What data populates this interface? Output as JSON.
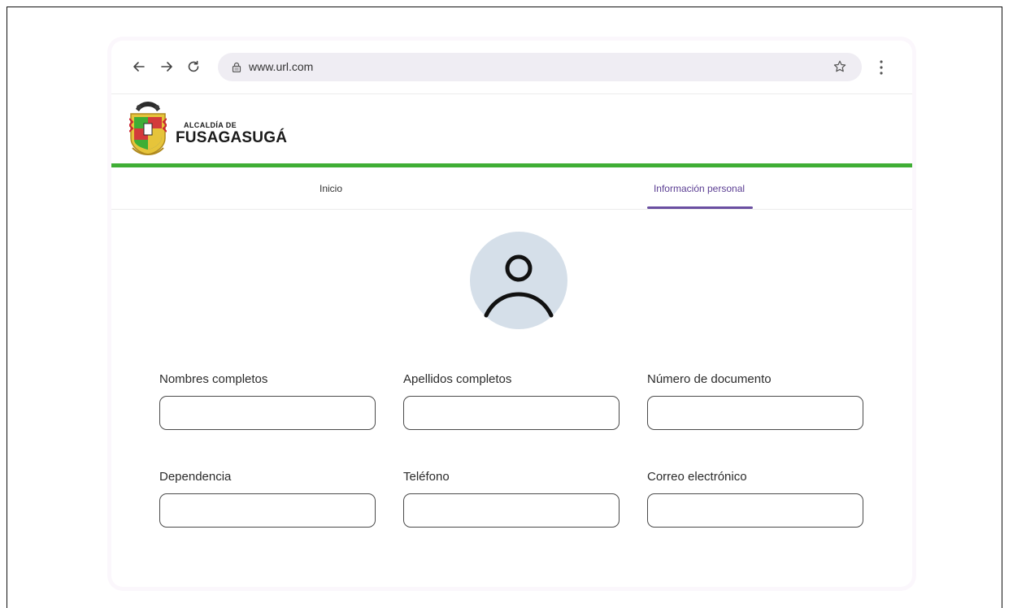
{
  "browser": {
    "url": "www.url.com",
    "icons": {
      "back": "arrow-left-icon",
      "forward": "arrow-right-icon",
      "reload": "reload-icon",
      "lock": "lock-icon",
      "bookmark": "star-icon",
      "menu": "kebab-menu-icon"
    }
  },
  "brand": {
    "line1": "ALCALDÍA DE",
    "line2": "FUSAGASUGÁ",
    "accent_color": "#3fae35"
  },
  "tabs": [
    {
      "label": "Inicio",
      "active": false
    },
    {
      "label": "Información personal",
      "active": true
    }
  ],
  "active_tab_color": "#6a4fa1",
  "avatar": {
    "icon": "user-avatar-icon",
    "bg_color": "#d5dfe9"
  },
  "form": {
    "fields": [
      {
        "label": "Nombres completos",
        "value": ""
      },
      {
        "label": "Apellidos completos",
        "value": ""
      },
      {
        "label": "Número de documento",
        "value": ""
      },
      {
        "label": "Dependencia",
        "value": ""
      },
      {
        "label": "Teléfono",
        "value": ""
      },
      {
        "label": "Correo electrónico",
        "value": ""
      }
    ]
  }
}
